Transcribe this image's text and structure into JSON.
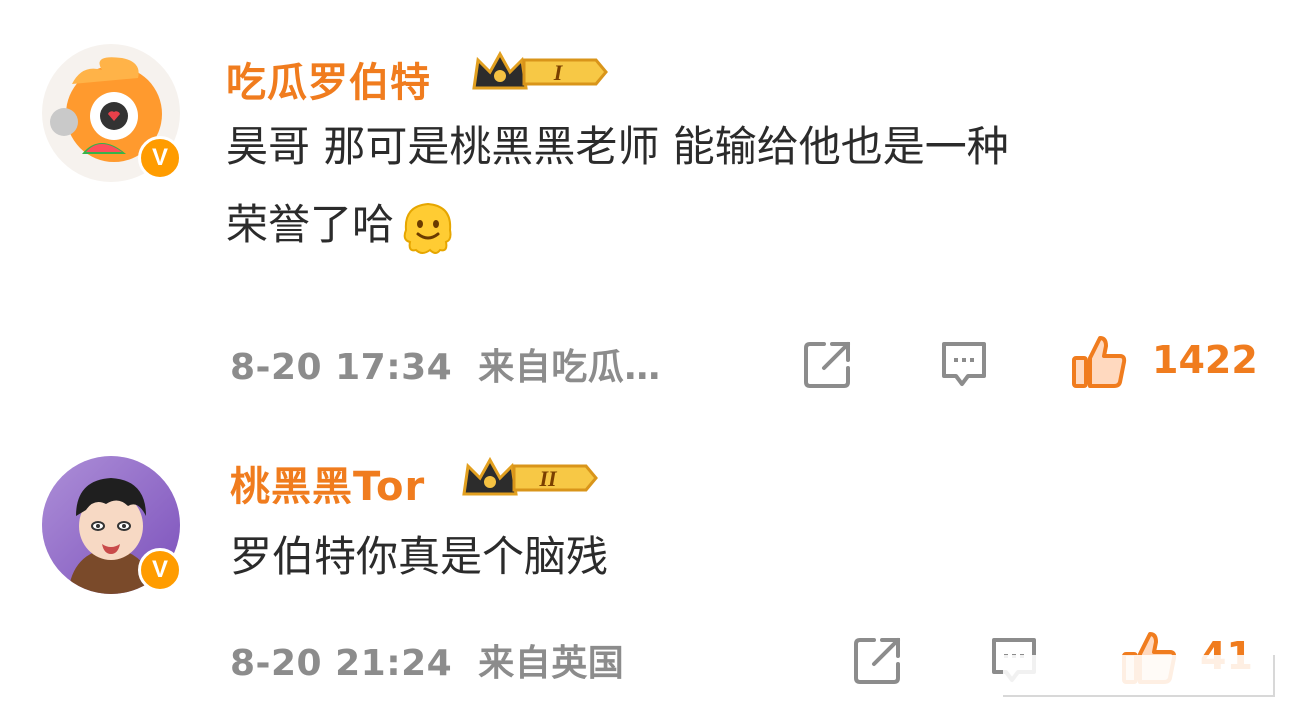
{
  "comments": [
    {
      "username": "吃瓜罗伯特",
      "rank": "I",
      "text_line1": "昊哥 那可是桃黑黑老师 能输给他也是一种",
      "text_line2": "荣誉了哈",
      "emoji": "melting-face-emoji",
      "timestamp": "8-20 17:34",
      "source": "来自吃瓜…",
      "likes": "1422",
      "verified": "V"
    },
    {
      "username": "桃黑黑Tor",
      "rank": "II",
      "text_line1": "罗伯特你真是个脑残",
      "timestamp": "8-20 21:24",
      "source": "来自英国",
      "likes": "41",
      "verified": "V"
    }
  ],
  "icons": [
    "share-icon",
    "comment-icon",
    "like-icon"
  ],
  "colors": {
    "accent": "#f07c1e",
    "meta": "#8c8c8c",
    "text": "#2b2b2b",
    "badge": "#ff9c00"
  }
}
